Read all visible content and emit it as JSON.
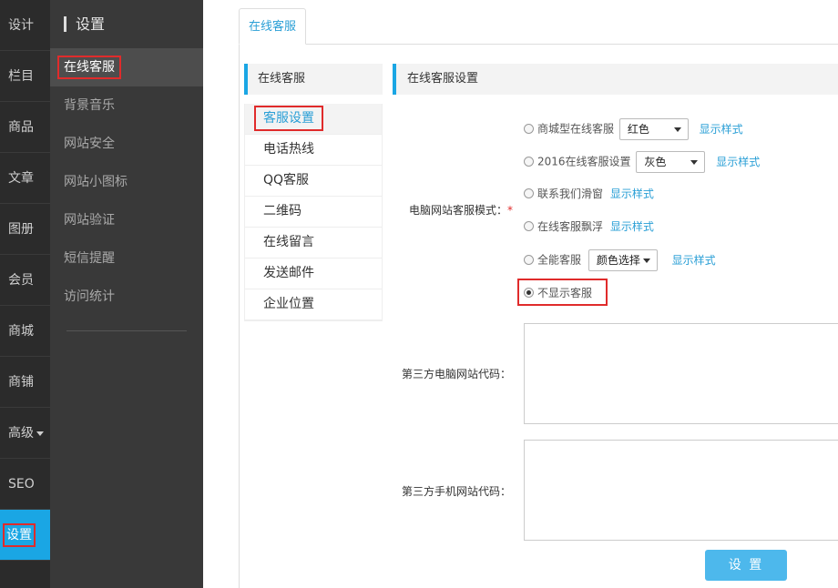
{
  "rail": {
    "items": [
      {
        "label": "设计"
      },
      {
        "label": "栏目"
      },
      {
        "label": "商品"
      },
      {
        "label": "文章"
      },
      {
        "label": "图册"
      },
      {
        "label": "会员"
      },
      {
        "label": "商城"
      },
      {
        "label": "商铺"
      },
      {
        "label": "高级"
      },
      {
        "label": "SEO"
      },
      {
        "label": "设置"
      }
    ]
  },
  "sidebar": {
    "title": "设置",
    "items": [
      {
        "label": "在线客服"
      },
      {
        "label": "背景音乐"
      },
      {
        "label": "网站安全"
      },
      {
        "label": "网站小图标"
      },
      {
        "label": "网站验证"
      },
      {
        "label": "短信提醒"
      },
      {
        "label": "访问统计"
      }
    ]
  },
  "main": {
    "tab": "在线客服",
    "menu": {
      "title": "在线客服",
      "items": [
        {
          "label": "客服设置"
        },
        {
          "label": "电话热线"
        },
        {
          "label": "QQ客服"
        },
        {
          "label": "二维码"
        },
        {
          "label": "在线留言"
        },
        {
          "label": "发送邮件"
        },
        {
          "label": "企业位置"
        }
      ]
    },
    "panel": {
      "title": "在线客服设置",
      "mode_label": "电脑网站客服模式：",
      "required_mark": "*",
      "options": [
        {
          "label": "商城型在线客服",
          "select": "红色",
          "link": "显示样式"
        },
        {
          "label": "2016在线客服设置",
          "select": "灰色",
          "link": "显示样式"
        },
        {
          "label": "联系我们滑窗",
          "link": "显示样式"
        },
        {
          "label": "在线客服飘浮",
          "link": "显示样式"
        },
        {
          "label": "全能客服",
          "select": "颜色选择",
          "link": "显示样式"
        },
        {
          "label": "不显示客服"
        }
      ],
      "selected_option": "不显示客服",
      "pc_code_label": "第三方电脑网站代码：",
      "pc_code_value": "",
      "mobile_code_label": "第三方手机网站代码：",
      "mobile_code_value": "",
      "submit_label": "设 置"
    }
  },
  "colors": {
    "accent": "#1aa6e4",
    "highlight": "#e02b2b",
    "button": "#4db8ec"
  }
}
